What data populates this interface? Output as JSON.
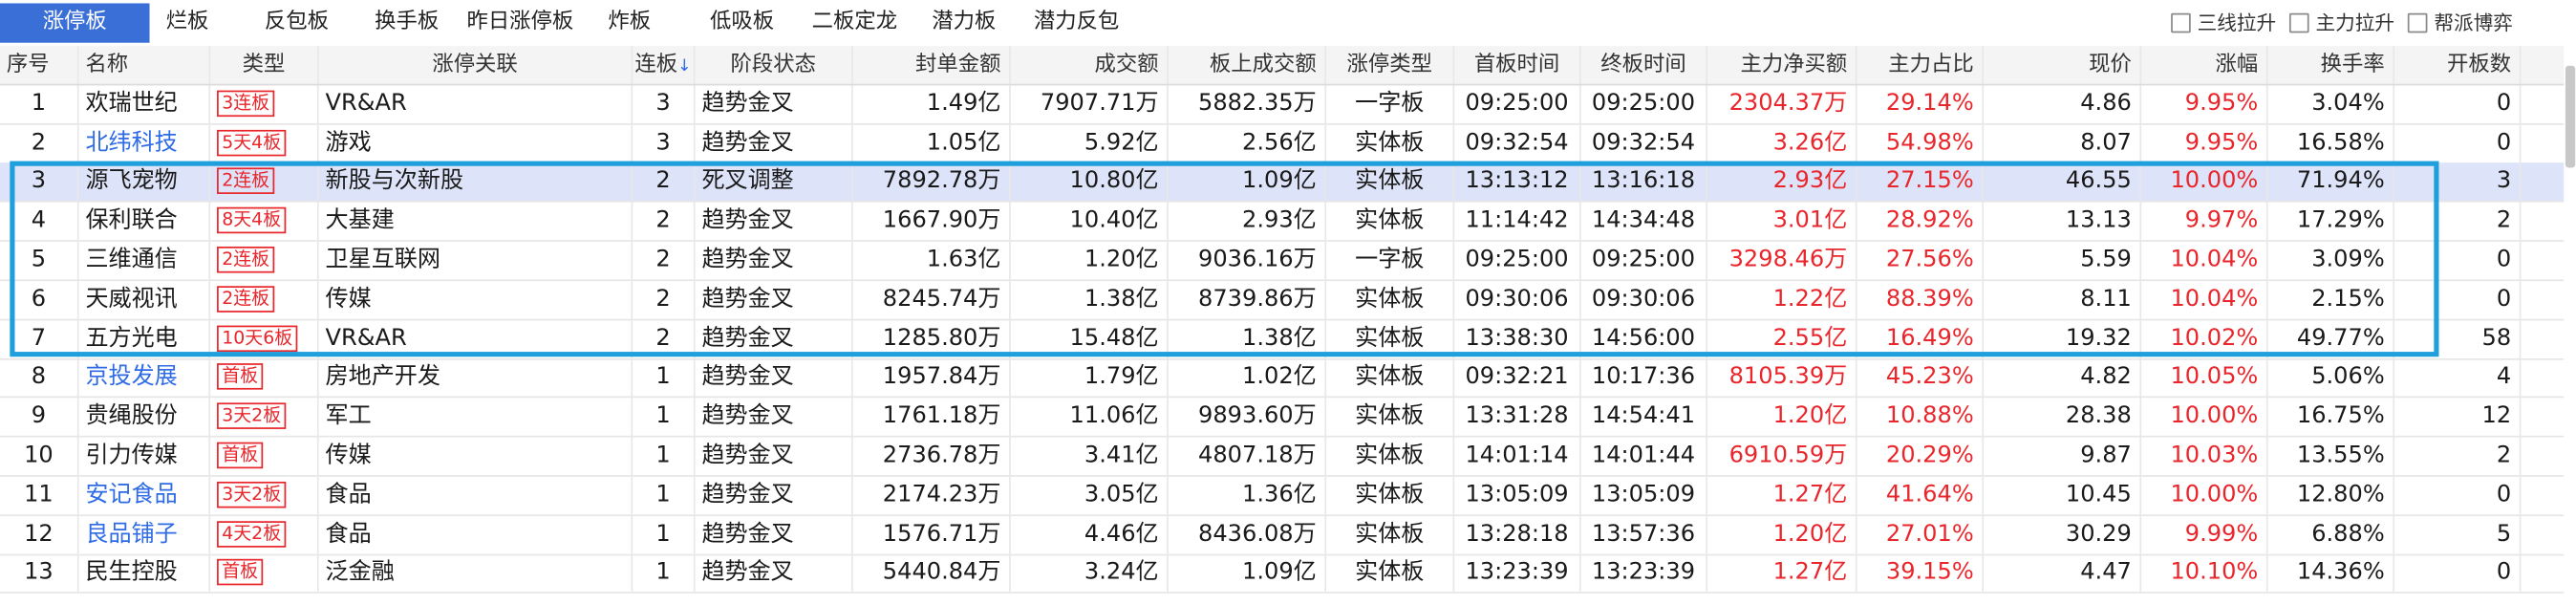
{
  "tabs": [
    {
      "label": "涨停板",
      "active": true
    },
    {
      "label": "烂板",
      "active": false
    },
    {
      "label": "反包板",
      "active": false
    },
    {
      "label": "换手板",
      "active": false
    },
    {
      "label": "昨日涨停板",
      "active": false
    },
    {
      "label": "炸板",
      "active": false
    },
    {
      "label": "低吸板",
      "active": false
    },
    {
      "label": "二板定龙",
      "active": false
    },
    {
      "label": "潜力板",
      "active": false
    },
    {
      "label": "潜力反包",
      "active": false
    }
  ],
  "options": [
    {
      "label": "三线拉升",
      "checked": false
    },
    {
      "label": "主力拉升",
      "checked": false
    },
    {
      "label": "帮派博弈",
      "checked": false
    }
  ],
  "columns": [
    "序号",
    "名称",
    "类型",
    "涨停关联",
    "连板",
    "阶段状态",
    "封单金额",
    "成交额",
    "板上成交额",
    "涨停类型",
    "首板时间",
    "终板时间",
    "主力净买额",
    "主力占比",
    "现价",
    "涨幅",
    "换手率",
    "开板数"
  ],
  "sort_indicator": "↓",
  "rows": [
    {
      "idx": "1",
      "name": "欢瑞世纪",
      "name_color": "black",
      "type": "3连板",
      "related": "VR&AR",
      "lianban": "3",
      "stage": "趋势金叉",
      "fengdan": "1.49亿",
      "chengjiao": "7907.71万",
      "banshang": "5882.35万",
      "zt_type": "一字板",
      "first": "09:25:00",
      "last": "09:25:00",
      "zhuli": "2304.37万",
      "zhanbi": "29.14%",
      "price": "4.86",
      "pct": "9.95%",
      "turnover": "3.04%",
      "open": "0"
    },
    {
      "idx": "2",
      "name": "北纬科技",
      "name_color": "blue",
      "type": "5天4板",
      "related": "游戏",
      "lianban": "3",
      "stage": "趋势金叉",
      "fengdan": "1.05亿",
      "chengjiao": "5.92亿",
      "banshang": "2.56亿",
      "zt_type": "实体板",
      "first": "09:32:54",
      "last": "09:32:54",
      "zhuli": "3.26亿",
      "zhanbi": "54.98%",
      "price": "8.07",
      "pct": "9.95%",
      "turnover": "16.58%",
      "open": "0"
    },
    {
      "idx": "3",
      "name": "源飞宠物",
      "name_color": "black",
      "type": "2连板",
      "related": "新股与次新股",
      "lianban": "2",
      "stage": "死叉调整",
      "fengdan": "7892.78万",
      "chengjiao": "10.80亿",
      "banshang": "1.09亿",
      "zt_type": "实体板",
      "first": "13:13:12",
      "last": "13:16:18",
      "zhuli": "2.93亿",
      "zhanbi": "27.15%",
      "price": "46.55",
      "pct": "10.00%",
      "turnover": "71.94%",
      "open": "3"
    },
    {
      "idx": "4",
      "name": "保利联合",
      "name_color": "black",
      "type": "8天4板",
      "related": "大基建",
      "lianban": "2",
      "stage": "趋势金叉",
      "fengdan": "1667.90万",
      "chengjiao": "10.40亿",
      "banshang": "2.93亿",
      "zt_type": "实体板",
      "first": "11:14:42",
      "last": "14:34:48",
      "zhuli": "3.01亿",
      "zhanbi": "28.92%",
      "price": "13.13",
      "pct": "9.97%",
      "turnover": "17.29%",
      "open": "2"
    },
    {
      "idx": "5",
      "name": "三维通信",
      "name_color": "black",
      "type": "2连板",
      "related": "卫星互联网",
      "lianban": "2",
      "stage": "趋势金叉",
      "fengdan": "1.63亿",
      "chengjiao": "1.20亿",
      "banshang": "9036.16万",
      "zt_type": "一字板",
      "first": "09:25:00",
      "last": "09:25:00",
      "zhuli": "3298.46万",
      "zhanbi": "27.56%",
      "price": "5.59",
      "pct": "10.04%",
      "turnover": "3.09%",
      "open": "0"
    },
    {
      "idx": "6",
      "name": "天威视讯",
      "name_color": "black",
      "type": "2连板",
      "related": "传媒",
      "lianban": "2",
      "stage": "趋势金叉",
      "fengdan": "8245.74万",
      "chengjiao": "1.38亿",
      "banshang": "8739.86万",
      "zt_type": "实体板",
      "first": "09:30:06",
      "last": "09:30:06",
      "zhuli": "1.22亿",
      "zhanbi": "88.39%",
      "price": "8.11",
      "pct": "10.04%",
      "turnover": "2.15%",
      "open": "0"
    },
    {
      "idx": "7",
      "name": "五方光电",
      "name_color": "black",
      "type": "10天6板",
      "related": "VR&AR",
      "lianban": "2",
      "stage": "趋势金叉",
      "fengdan": "1285.80万",
      "chengjiao": "15.48亿",
      "banshang": "1.38亿",
      "zt_type": "实体板",
      "first": "13:38:30",
      "last": "14:56:00",
      "zhuli": "2.55亿",
      "zhanbi": "16.49%",
      "price": "19.32",
      "pct": "10.02%",
      "turnover": "49.77%",
      "open": "58"
    },
    {
      "idx": "8",
      "name": "京投发展",
      "name_color": "blue",
      "type": "首板",
      "related": "房地产开发",
      "lianban": "1",
      "stage": "趋势金叉",
      "fengdan": "1957.84万",
      "chengjiao": "1.79亿",
      "banshang": "1.02亿",
      "zt_type": "实体板",
      "first": "09:32:21",
      "last": "10:17:36",
      "zhuli": "8105.39万",
      "zhanbi": "45.23%",
      "price": "4.82",
      "pct": "10.05%",
      "turnover": "5.06%",
      "open": "4"
    },
    {
      "idx": "9",
      "name": "贵绳股份",
      "name_color": "black",
      "type": "3天2板",
      "related": "军工",
      "lianban": "1",
      "stage": "趋势金叉",
      "fengdan": "1761.18万",
      "chengjiao": "11.06亿",
      "banshang": "9893.60万",
      "zt_type": "实体板",
      "first": "13:31:28",
      "last": "14:54:41",
      "zhuli": "1.20亿",
      "zhanbi": "10.88%",
      "price": "28.38",
      "pct": "10.00%",
      "turnover": "16.75%",
      "open": "12"
    },
    {
      "idx": "10",
      "name": "引力传媒",
      "name_color": "black",
      "type": "首板",
      "related": "传媒",
      "lianban": "1",
      "stage": "趋势金叉",
      "fengdan": "2736.78万",
      "chengjiao": "3.41亿",
      "banshang": "4807.18万",
      "zt_type": "实体板",
      "first": "14:01:14",
      "last": "14:01:44",
      "zhuli": "6910.59万",
      "zhanbi": "20.29%",
      "price": "9.87",
      "pct": "10.03%",
      "turnover": "13.55%",
      "open": "2"
    },
    {
      "idx": "11",
      "name": "安记食品",
      "name_color": "blue",
      "type": "3天2板",
      "related": "食品",
      "lianban": "1",
      "stage": "趋势金叉",
      "fengdan": "2174.23万",
      "chengjiao": "3.05亿",
      "banshang": "1.36亿",
      "zt_type": "实体板",
      "first": "13:05:09",
      "last": "13:05:09",
      "zhuli": "1.27亿",
      "zhanbi": "41.64%",
      "price": "10.45",
      "pct": "10.00%",
      "turnover": "12.80%",
      "open": "0"
    },
    {
      "idx": "12",
      "name": "良品铺子",
      "name_color": "blue",
      "type": "4天2板",
      "related": "食品",
      "lianban": "1",
      "stage": "趋势金叉",
      "fengdan": "1576.71万",
      "chengjiao": "4.46亿",
      "banshang": "8436.08万",
      "zt_type": "实体板",
      "first": "13:28:18",
      "last": "13:57:36",
      "zhuli": "1.20亿",
      "zhanbi": "27.01%",
      "price": "30.29",
      "pct": "9.99%",
      "turnover": "6.88%",
      "open": "5"
    },
    {
      "idx": "13",
      "name": "民生控股",
      "name_color": "black",
      "type": "首板",
      "related": "泛金融",
      "lianban": "1",
      "stage": "趋势金叉",
      "fengdan": "5440.84万",
      "chengjiao": "3.24亿",
      "banshang": "1.09亿",
      "zt_type": "实体板",
      "first": "13:23:39",
      "last": "13:23:39",
      "zhuli": "1.27亿",
      "zhanbi": "39.15%",
      "price": "4.47",
      "pct": "10.10%",
      "turnover": "14.36%",
      "open": "0"
    }
  ],
  "colors": {
    "accent": "#3a6fd8",
    "up_red": "#e8262b",
    "link_blue": "#2e6be5",
    "highlight_frame": "#1fa0dc",
    "selected_row": "#dde3f8"
  }
}
